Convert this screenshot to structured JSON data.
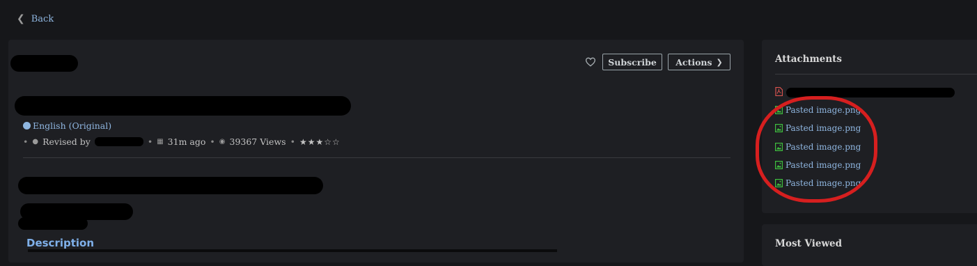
{
  "nav": {
    "back_label": "Back"
  },
  "article": {
    "subscribe_label": "Subscribe",
    "actions_label": "Actions",
    "language": "English (Original)",
    "revised_label": "Revised by",
    "time_ago": "31m ago",
    "views": "39367 Views",
    "stars": "★★★☆☆",
    "rating": 3,
    "rating_max": 5,
    "description_heading": "Description"
  },
  "sidebar": {
    "attachments_title": "Attachments",
    "attachments": [
      {
        "name": "Pasted image.png",
        "icon": "image-file-icon"
      },
      {
        "name": "Pasted image.png",
        "icon": "image-file-icon"
      },
      {
        "name": "Pasted image.png",
        "icon": "image-file-icon"
      },
      {
        "name": "Pasted image.png",
        "icon": "image-file-icon"
      },
      {
        "name": "Pasted image.png",
        "icon": "image-file-icon"
      }
    ],
    "most_viewed_title": "Most Viewed"
  },
  "colors": {
    "background": "#16171a",
    "card": "#1e1f23",
    "link": "#8fb6e0",
    "heading_blue": "#7fb0ea",
    "image_icon": "#3fbf3f",
    "pdf_icon": "#d9534f",
    "annotation_circle": "#d61f1f"
  }
}
